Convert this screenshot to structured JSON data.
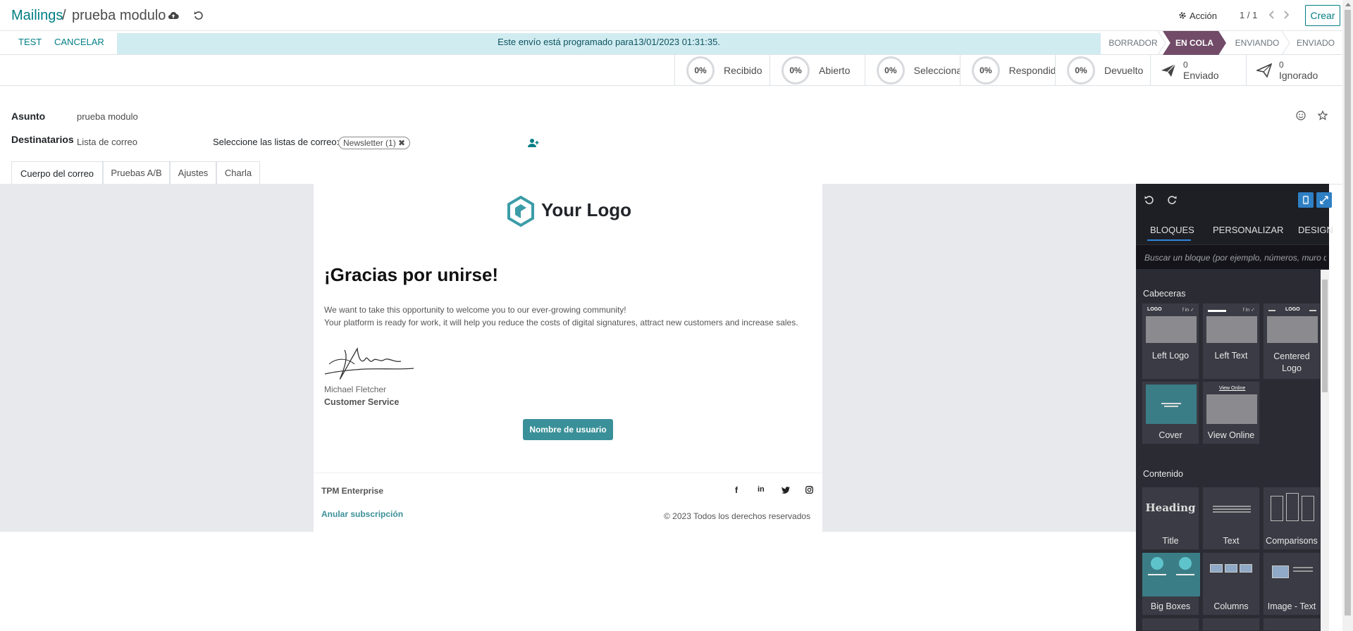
{
  "breadcrumb": {
    "parent": "Mailings",
    "separator": "/",
    "current": "prueba modulo"
  },
  "topbar": {
    "action_label": "Acción",
    "pager": "1 / 1",
    "create_label": "Crear"
  },
  "statusbar": {
    "test_label": "TEST",
    "cancel_label": "CANCELAR",
    "schedule_message": "Este envío está programado para13/01/2023 01:31:35.",
    "stages": [
      "BORRADOR",
      "EN COLA",
      "ENVIANDO",
      "ENVIADO"
    ],
    "active_stage": "EN COLA"
  },
  "stats": [
    {
      "value": "0%",
      "label": "Recibido"
    },
    {
      "value": "0%",
      "label": "Abierto"
    },
    {
      "value": "0%",
      "label": "Seleccionado"
    },
    {
      "value": "0%",
      "label": "Respondido"
    },
    {
      "value": "0%",
      "label": "Devuelto"
    }
  ],
  "counters": [
    {
      "count": "0",
      "label": "Enviado"
    },
    {
      "count": "0",
      "label": "Ignorado"
    }
  ],
  "form": {
    "subject_label": "Asunto",
    "subject_value": "prueba modulo",
    "recipients_label": "Destinatarios",
    "recipients_value": "Lista de correo",
    "lists_label": "Seleccione las listas de correo:",
    "list_tag": "Newsletter (1)"
  },
  "tabs": [
    "Cuerpo del correo",
    "Pruebas A/B",
    "Ajustes",
    "Charla"
  ],
  "mail": {
    "logo_text": "Your Logo",
    "heading": "¡Gracias por unirse!",
    "para1": "We want to take this opportunity to welcome you to our ever-growing community!",
    "para2": "Your platform is ready for work, it will help you reduce the costs of digital signatures, attract new customers and increase sales.",
    "signer_name": "Michael Fletcher",
    "signer_role": "Customer Service",
    "button_label": "Nombre de usuario",
    "footer_company": "TPM Enterprise",
    "unsubscribe": "Anular subscripción",
    "copyright": "© 2023 Todos los derechos reservados"
  },
  "sidebar": {
    "tabs": [
      "BLOQUES",
      "PERSONALIZAR",
      "DESIGN"
    ],
    "active_tab": "BLOQUES",
    "search_placeholder": "Buscar un bloque (por ejemplo, números, muro de",
    "section_headers": "Cabeceras",
    "header_blocks": [
      "Left Logo",
      "Left Text",
      "Centered Logo",
      "Cover",
      "View Online"
    ],
    "section_content": "Contenido",
    "content_blocks": [
      "Title",
      "Text",
      "Comparisons",
      "Big Boxes",
      "Columns",
      "Image - Text"
    ],
    "thumb_logo": "LOGO",
    "thumb_heading": "Heading",
    "thumb_view_online": "View Online"
  },
  "colors": {
    "primary": "#017e84",
    "stage_active": "#714b67",
    "info_bg": "#d1ecf1",
    "sidebar_bg": "#1e1e25"
  }
}
